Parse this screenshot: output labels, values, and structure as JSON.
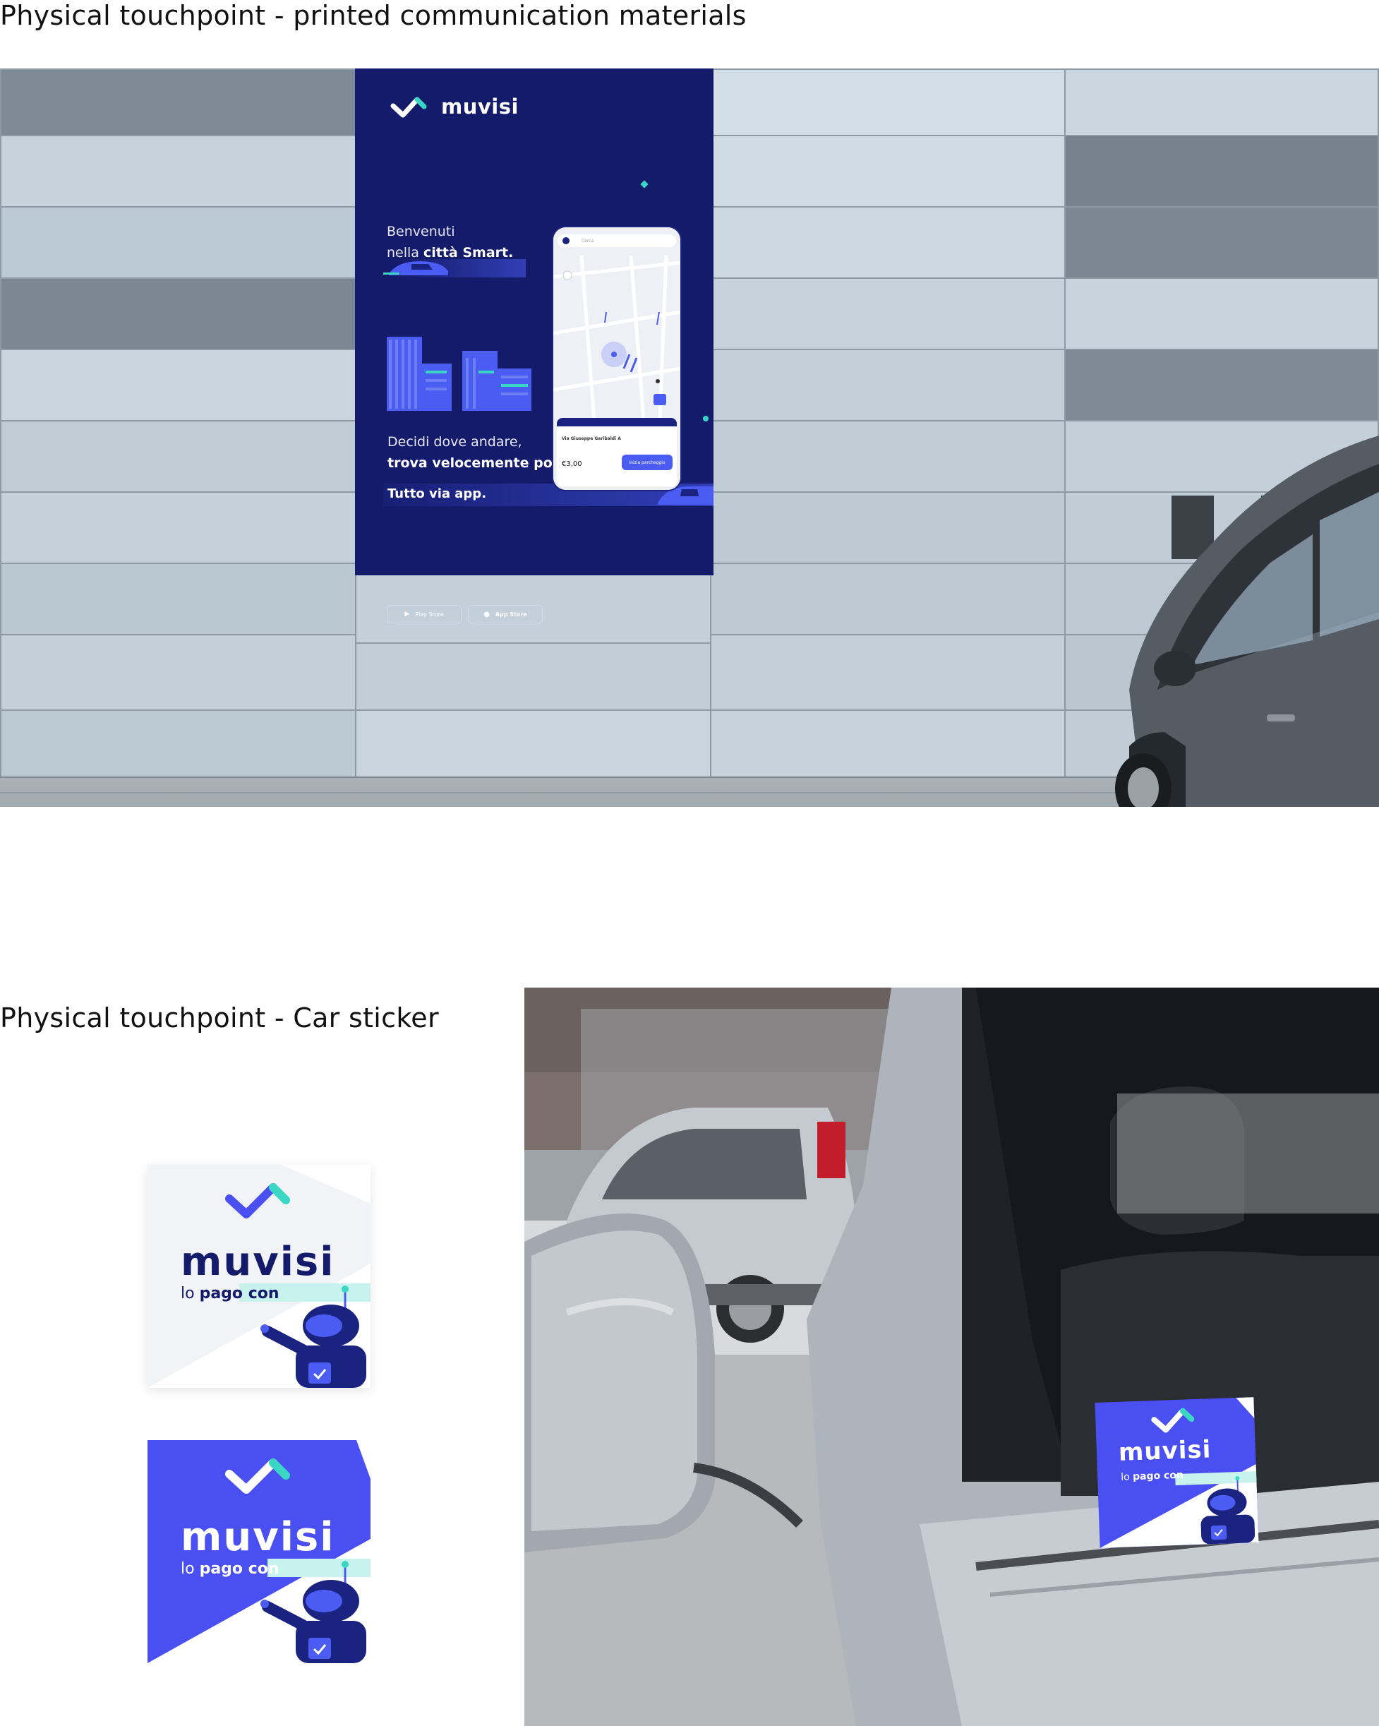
{
  "headings": {
    "printed": "Physical touchpoint - printed communication materials",
    "sticker": "Physical touchpoint - Car sticker"
  },
  "poster": {
    "brand": "muvisi",
    "welcome_line1": "Benvenuti",
    "welcome_line2_prefix": "nella ",
    "welcome_line2_bold": "città Smart.",
    "decide_line1": "Decidi dove andare,",
    "decide_line2": "trova velocemente posto.",
    "tagline": "Tutto via app.",
    "play_store": "Play Store",
    "app_store": "App Store",
    "colors": {
      "background": "#141b6b",
      "accent": "#4a5cf2",
      "mint": "#3ad6c4"
    }
  },
  "phone": {
    "search_placeholder": "Cerca",
    "address": "Via Giuseppe Garibaldi A",
    "price": "€3,00",
    "cta": "Inizia parcheggio"
  },
  "stickers": {
    "light": {
      "brand": "muvisi",
      "sub_prefix": "lo ",
      "sub_bold": "pago con"
    },
    "blue": {
      "brand": "muvisi",
      "sub_prefix": "lo ",
      "sub_bold": "pago con"
    },
    "window": {
      "brand": "muvisi",
      "sub_prefix": "lo ",
      "sub_bold": "pago con"
    }
  },
  "icons": [
    "muvisi-check-logo-icon",
    "play-store-icon",
    "apple-icon",
    "robot-mascot-icon",
    "car-icon",
    "building-icon"
  ]
}
